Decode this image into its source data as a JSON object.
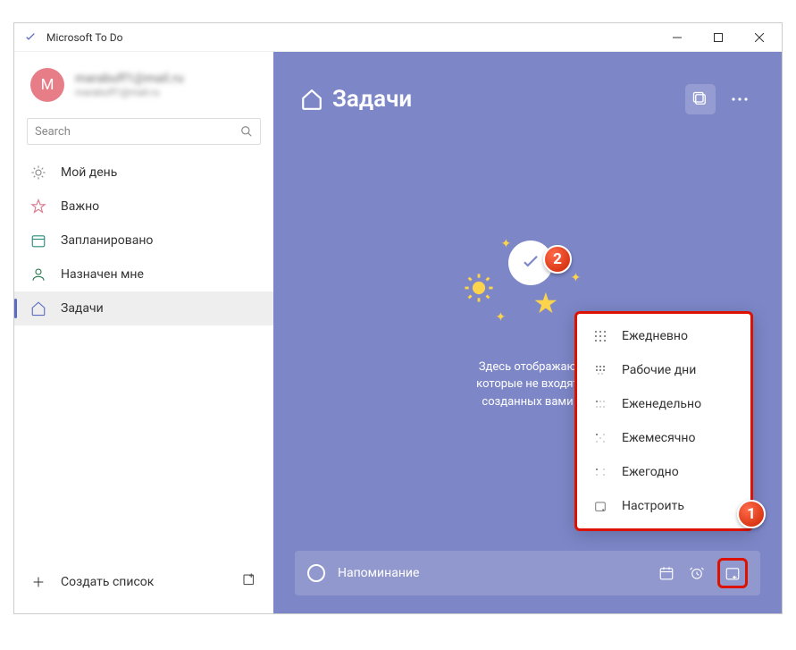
{
  "window": {
    "title": "Microsoft To Do"
  },
  "profile": {
    "initial": "M",
    "name": "marabuff1@mail.ru",
    "email": "marabuff1@mail.ru"
  },
  "search": {
    "placeholder": "Search"
  },
  "nav": {
    "myday": "Мой день",
    "important": "Важно",
    "planned": "Запланировано",
    "assigned": "Назначен мне",
    "tasks": "Задачи"
  },
  "footer": {
    "create_list": "Создать список"
  },
  "main": {
    "title": "Задачи",
    "empty_line1": "Здесь отображаю",
    "empty_line2": "которые не входят",
    "empty_line3": "созданных вами"
  },
  "add_task": {
    "placeholder": "Напоминание"
  },
  "popup": {
    "daily": "Ежедневно",
    "weekdays": "Рабочие дни",
    "weekly": "Еженедельно",
    "monthly": "Ежемесячно",
    "yearly": "Ежегодно",
    "custom": "Настроить"
  },
  "annotations": {
    "one": "1",
    "two": "2"
  }
}
